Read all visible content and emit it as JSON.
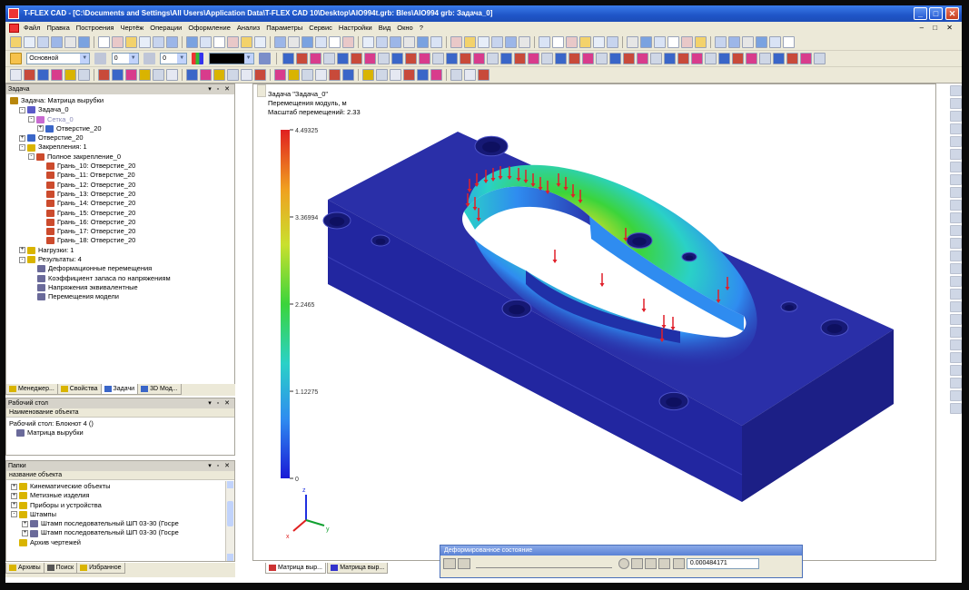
{
  "window": {
    "title": "T-FLEX CAD - [C:\\Documents and Settings\\All Users\\Application Data\\T-FLEX CAD 10\\Desktop\\AIO994t.grb: Bles\\AIO994 grb: Задача_0]",
    "controls": [
      "_",
      "□",
      "✕"
    ]
  },
  "menu": {
    "items": [
      "Файл",
      "Правка",
      "Построения",
      "Чертёж",
      "Операции",
      "Оформление",
      "Анализ",
      "Параметры",
      "Сервис",
      "Настройки",
      "Вид",
      "Окно",
      "?"
    ]
  },
  "toolbar_row3": {
    "layer_combo": "Основной",
    "num1": "0",
    "num2": "0"
  },
  "tree_panel": {
    "header": "Задача",
    "items": [
      {
        "label": "Задача: Матрица вырубки",
        "indent": 0,
        "icon": "task-icon",
        "color": "#b8860b",
        "exp": ""
      },
      {
        "label": "Задача_0",
        "indent": 1,
        "icon": "task-icon",
        "color": "#5a5ac8",
        "exp": "-"
      },
      {
        "label": "Сетка_0",
        "indent": 2,
        "icon": "mesh-icon",
        "color": "#c86ad1",
        "exp": "-",
        "muted": true
      },
      {
        "label": "Отверстие_20",
        "indent": 3,
        "icon": "hole-icon",
        "color": "#3a66c8",
        "exp": "+"
      },
      {
        "label": "Отверстие_20",
        "indent": 1,
        "icon": "hole-icon",
        "color": "#3a66c8",
        "exp": "+"
      },
      {
        "label": "Закрепления: 1",
        "indent": 1,
        "icon": "folder-icon",
        "color": "#d9b400",
        "exp": "-"
      },
      {
        "label": "Полное закрепление_0",
        "indent": 2,
        "icon": "fixed-constraint-icon",
        "color": "#cc4b2d",
        "exp": "-"
      },
      {
        "label": "Грань_10: Отверстие_20",
        "indent": 4,
        "icon": "face-icon",
        "color": "#cc4b2d",
        "exp": ""
      },
      {
        "label": "Грань_11: Отверстие_20",
        "indent": 4,
        "icon": "face-icon",
        "color": "#cc4b2d",
        "exp": ""
      },
      {
        "label": "Грань_12: Отверстие_20",
        "indent": 4,
        "icon": "face-icon",
        "color": "#cc4b2d",
        "exp": ""
      },
      {
        "label": "Грань_13: Отверстие_20",
        "indent": 4,
        "icon": "face-icon",
        "color": "#cc4b2d",
        "exp": ""
      },
      {
        "label": "Грань_14: Отверстие_20",
        "indent": 4,
        "icon": "face-icon",
        "color": "#cc4b2d",
        "exp": ""
      },
      {
        "label": "Грань_15: Отверстие_20",
        "indent": 4,
        "icon": "face-icon",
        "color": "#cc4b2d",
        "exp": ""
      },
      {
        "label": "Грань_16: Отверстие_20",
        "indent": 4,
        "icon": "face-icon",
        "color": "#cc4b2d",
        "exp": ""
      },
      {
        "label": "Грань_17: Отверстие_20",
        "indent": 4,
        "icon": "face-icon",
        "color": "#cc4b2d",
        "exp": ""
      },
      {
        "label": "Грань_18: Отверстие_20",
        "indent": 4,
        "icon": "face-icon",
        "color": "#cc4b2d",
        "exp": ""
      },
      {
        "label": "Нагрузки: 1",
        "indent": 1,
        "icon": "folder-icon",
        "color": "#d9b400",
        "exp": "+"
      },
      {
        "label": "Результаты: 4",
        "indent": 1,
        "icon": "folder-icon",
        "color": "#d9b400",
        "exp": "-"
      },
      {
        "label": "Деформационные перемещения",
        "indent": 3,
        "icon": "result-icon",
        "color": "#6a6a9a",
        "exp": ""
      },
      {
        "label": "Коэффициент запаса по напряжениям",
        "indent": 3,
        "icon": "result-icon",
        "color": "#6a6a9a",
        "exp": ""
      },
      {
        "label": "Напряжения эквивалентные",
        "indent": 3,
        "icon": "result-icon",
        "color": "#6a6a9a",
        "exp": ""
      },
      {
        "label": "Перемещения модели",
        "indent": 3,
        "icon": "result-icon",
        "color": "#6a6a9a",
        "exp": ""
      }
    ],
    "tabs": [
      {
        "label": "Менеджер...",
        "icon": "#d9b400"
      },
      {
        "label": "Свойства",
        "icon": "#d9b400"
      },
      {
        "label": "Задачи",
        "icon": "#3a66c8",
        "active": true
      },
      {
        "label": "3D Мод...",
        "icon": "#3a66c8"
      }
    ]
  },
  "workplane_panel": {
    "header": "Рабочий стол",
    "subheader": "Наименование объекта",
    "rows": [
      "Рабочий стол: Блокнот 4 ()",
      "Матрица вырубки"
    ]
  },
  "library_panel": {
    "header": "Папки",
    "subheader": "название объекта",
    "items": [
      {
        "label": "Кинематические объекты",
        "indent": 0,
        "exp": "+"
      },
      {
        "label": "Метизные изделия",
        "indent": 0,
        "exp": "+"
      },
      {
        "label": "Приборы и устройства",
        "indent": 0,
        "exp": "+"
      },
      {
        "label": "Штампы",
        "indent": 0,
        "exp": "-"
      },
      {
        "label": "Штамп последовательный ШП 03-30 (Госре",
        "indent": 1,
        "exp": "+"
      },
      {
        "label": "Штамп последовательный ШП 03-30 (Госре",
        "indent": 1,
        "exp": "+"
      },
      {
        "label": "Архив чертежей",
        "indent": 0,
        "exp": ""
      }
    ],
    "tabs": [
      {
        "label": "Архивы",
        "icon": "#d9b400"
      },
      {
        "label": "Поиск",
        "icon": "#555"
      },
      {
        "label": "Избранное",
        "icon": "#d9b400"
      }
    ]
  },
  "viewport": {
    "info_lines": [
      "Задача \"Задача_0\"",
      "Перемещения модуль, м",
      "Масштаб перемещений: 2.33"
    ],
    "tabs": [
      "Матрица выр...",
      "Матрица выр..."
    ]
  },
  "chart_data": {
    "type": "heatmap",
    "title": "",
    "legend_ticks": [
      "4.49325",
      "3.36994",
      "2.2465",
      "1.12275",
      "0"
    ],
    "legend_values": [
      4.49325,
      3.36994,
      2.2465,
      1.12275,
      0
    ],
    "colormap": [
      "#1a1ad6",
      "#2f8cf0",
      "#2ad1c7",
      "#3bd43b",
      "#c9e02e",
      "#f0a020",
      "#e02020"
    ],
    "axes": [
      "x",
      "y",
      "z"
    ],
    "axis_colors": {
      "x": "#e02020",
      "y": "#10a030",
      "z": "#2030e0"
    }
  },
  "status_dialog": {
    "title": "Деформированное состояние",
    "value": "0.000484171"
  },
  "colors": {
    "model_blue": "#2a2fa8",
    "model_dark": "#1c1f86",
    "titlebar": "#1f55c7"
  }
}
